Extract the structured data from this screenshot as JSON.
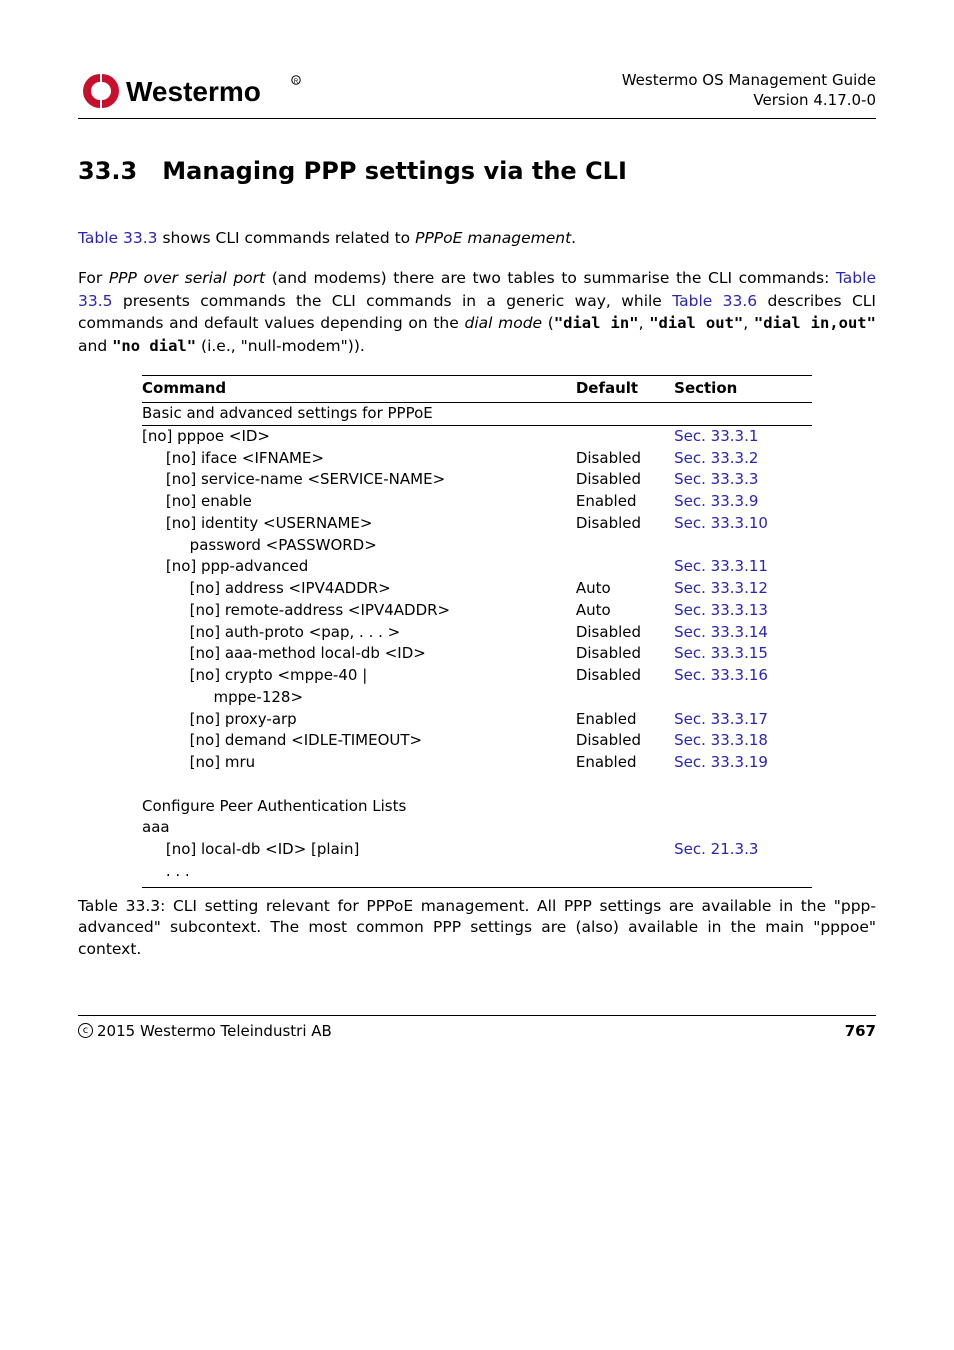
{
  "header": {
    "title_line1": "Westermo OS Management Guide",
    "title_line2": "Version 4.17.0-0"
  },
  "section": {
    "number": "33.3",
    "title": "Managing PPP settings via the CLI"
  },
  "para1": {
    "pre": "",
    "link1": "Table 33.3",
    "mid1": " shows CLI commands related to ",
    "ital1": "PPPoE management",
    "post": "."
  },
  "para2": {
    "t1": "For ",
    "ital1": "PPP over serial port",
    "t2": " (and modems) there are two tables to summarise the CLI commands: ",
    "link1": "Table 33.5",
    "t3": " presents commands the CLI commands in a generic way, while ",
    "link2": "Table 33.6",
    "t4": " describes CLI commands and default values depending on the ",
    "ital2": "dial mode",
    "t5": " (",
    "c1": "\"dial in\"",
    "t6": ", ",
    "c2": "\"dial out\"",
    "t7": ", ",
    "c3": "\"dial in,out\"",
    "t8": " and ",
    "c4": "\"no dial\"",
    "t9": " (i.e., \"null-modem\"))."
  },
  "table": {
    "head": {
      "c1": "Command",
      "c2": "Default",
      "c3": "Section"
    },
    "span1": "Basic and advanced settings for PPPoE",
    "rows": [
      {
        "cmd": "[no] pppoe <ID>",
        "def": "",
        "sec": "Sec. 33.3.1",
        "indent": 0
      },
      {
        "cmd": "[no] iface <IFNAME>",
        "def": "Disabled",
        "sec": "Sec. 33.3.2",
        "indent": 1
      },
      {
        "cmd": "[no] service-name <SERVICE-NAME>",
        "def": "Disabled",
        "sec": "Sec. 33.3.3",
        "indent": 1
      },
      {
        "cmd": "[no] enable",
        "def": "Enabled",
        "sec": "Sec. 33.3.9",
        "indent": 1
      },
      {
        "cmd": "[no] identity <USERNAME>",
        "def": "Disabled",
        "sec": "Sec. 33.3.10",
        "indent": 1
      },
      {
        "cmd": "password <PASSWORD>",
        "def": "",
        "sec": "",
        "indent": 2
      },
      {
        "cmd": "[no] ppp-advanced",
        "def": "",
        "sec": "Sec. 33.3.11",
        "indent": 1
      },
      {
        "cmd": "[no] address <IPV4ADDR>",
        "def": "Auto",
        "sec": "Sec. 33.3.12",
        "indent": 2
      },
      {
        "cmd": "[no] remote-address <IPV4ADDR>",
        "def": "Auto",
        "sec": "Sec. 33.3.13",
        "indent": 2
      },
      {
        "cmd": "[no] auth-proto <pap, . . . >",
        "def": "Disabled",
        "sec": "Sec. 33.3.14",
        "indent": 2
      },
      {
        "cmd": "[no] aaa-method local-db <ID>",
        "def": "Disabled",
        "sec": "Sec. 33.3.15",
        "indent": 2
      },
      {
        "cmd": "[no] crypto <mppe-40 |",
        "def": "Disabled",
        "sec": "Sec. 33.3.16",
        "indent": 2
      },
      {
        "cmd": "mppe-128>",
        "def": "",
        "sec": "",
        "indent": 3
      },
      {
        "cmd": "[no] proxy-arp",
        "def": "Enabled",
        "sec": "Sec. 33.3.17",
        "indent": 2
      },
      {
        "cmd": "[no] demand <IDLE-TIMEOUT>",
        "def": "Disabled",
        "sec": "Sec. 33.3.18",
        "indent": 2
      },
      {
        "cmd": "[no] mru",
        "def": "Enabled",
        "sec": "Sec. 33.3.19",
        "indent": 2
      }
    ],
    "gap_row": {
      "cmd": " ",
      "def": "",
      "sec": "",
      "indent": 0
    },
    "rows2": [
      {
        "cmd": "Configure Peer Authentication Lists",
        "def": "",
        "sec": "",
        "indent": -1
      },
      {
        "cmd": "aaa",
        "def": "",
        "sec": "",
        "indent": 0
      },
      {
        "cmd": "[no] local-db <ID> [plain]",
        "def": "",
        "sec": "Sec. 21.3.3",
        "indent": 1
      },
      {
        "cmd": ". . .",
        "def": "",
        "sec": "",
        "indent": 1,
        "bottom": true
      }
    ]
  },
  "caption": "Table 33.3: CLI setting relevant for PPPoE management. All PPP settings are available in the \"ppp-advanced\" subcontext. The most common PPP settings are (also) available in the main \"pppoe\" context.",
  "footer": {
    "copyright": "2015 Westermo Teleindustri AB",
    "page": "767"
  },
  "chart_data": {
    "type": "table",
    "title": "CLI setting relevant for PPPoE management",
    "columns": [
      "Command",
      "Default",
      "Section"
    ],
    "rows": [
      [
        "Basic and advanced settings for PPPoE",
        "",
        ""
      ],
      [
        "[no] pppoe <ID>",
        "",
        "Sec. 33.3.1"
      ],
      [
        "  [no] iface <IFNAME>",
        "Disabled",
        "Sec. 33.3.2"
      ],
      [
        "  [no] service-name <SERVICE-NAME>",
        "Disabled",
        "Sec. 33.3.3"
      ],
      [
        "  [no] enable",
        "Enabled",
        "Sec. 33.3.9"
      ],
      [
        "  [no] identity <USERNAME>",
        "Disabled",
        "Sec. 33.3.10"
      ],
      [
        "    password <PASSWORD>",
        "",
        ""
      ],
      [
        "  [no] ppp-advanced",
        "",
        "Sec. 33.3.11"
      ],
      [
        "    [no] address <IPV4ADDR>",
        "Auto",
        "Sec. 33.3.12"
      ],
      [
        "    [no] remote-address <IPV4ADDR>",
        "Auto",
        "Sec. 33.3.13"
      ],
      [
        "    [no] auth-proto <pap, ... >",
        "Disabled",
        "Sec. 33.3.14"
      ],
      [
        "    [no] aaa-method local-db <ID>",
        "Disabled",
        "Sec. 33.3.15"
      ],
      [
        "    [no] crypto <mppe-40 | mppe-128>",
        "Disabled",
        "Sec. 33.3.16"
      ],
      [
        "    [no] proxy-arp",
        "Enabled",
        "Sec. 33.3.17"
      ],
      [
        "    [no] demand <IDLE-TIMEOUT>",
        "Disabled",
        "Sec. 33.3.18"
      ],
      [
        "    [no] mru",
        "Enabled",
        "Sec. 33.3.19"
      ],
      [
        "Configure Peer Authentication Lists",
        "",
        ""
      ],
      [
        "aaa",
        "",
        ""
      ],
      [
        "  [no] local-db <ID> [plain]",
        "",
        "Sec. 21.3.3"
      ],
      [
        "  ...",
        "",
        ""
      ]
    ]
  }
}
